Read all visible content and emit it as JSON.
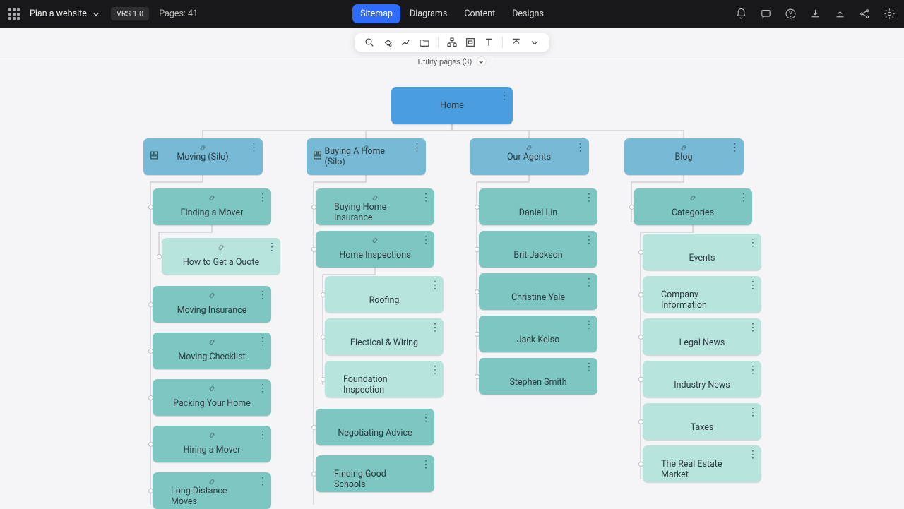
{
  "header": {
    "project_name": "Plan a website",
    "version_pill": "VRS 1.0",
    "pages_label": "Pages: 41",
    "tabs": {
      "sitemap": "Sitemap",
      "diagrams": "Diagrams",
      "content": "Content",
      "designs": "Designs"
    }
  },
  "utility_strip": {
    "label": "Utility pages (3)"
  },
  "sitemap": {
    "root": "Home",
    "sections": [
      {
        "title": "Moving (Silo)",
        "has_silo_icon": true,
        "children": [
          {
            "title": "Finding a Mover",
            "link": true,
            "children": [
              {
                "title": "How to Get a Quote",
                "link": true
              }
            ]
          },
          {
            "title": "Moving Insurance",
            "link": true
          },
          {
            "title": "Moving Checklist",
            "link": true
          },
          {
            "title": "Packing Your Home",
            "link": true
          },
          {
            "title": "Hiring a Mover",
            "link": true
          },
          {
            "title": "Long Distance Moves",
            "link": true
          }
        ]
      },
      {
        "title": "Buying A Home (Silo)",
        "has_silo_icon": true,
        "children": [
          {
            "title": "Buying Home Insurance",
            "link": true
          },
          {
            "title": "Home Inspections",
            "link": true,
            "children": [
              {
                "title": "Roofing"
              },
              {
                "title": "Electical & Wiring"
              },
              {
                "title": "Foundation Inspection"
              }
            ]
          },
          {
            "title": "Negotiating Advice"
          },
          {
            "title": "Finding Good Schools"
          }
        ]
      },
      {
        "title": "Our Agents",
        "has_silo_icon": false,
        "children": [
          {
            "title": "Daniel Lin"
          },
          {
            "title": "Brit Jackson"
          },
          {
            "title": "Christine Yale"
          },
          {
            "title": "Jack Kelso"
          },
          {
            "title": "Stephen Smith"
          }
        ]
      },
      {
        "title": "Blog",
        "has_silo_icon": false,
        "children": [
          {
            "title": "Categories",
            "link": true,
            "children": [
              {
                "title": "Events"
              },
              {
                "title": "Company Information"
              },
              {
                "title": "Legal News"
              },
              {
                "title": "Industry News"
              },
              {
                "title": "Taxes"
              },
              {
                "title": "The Real Estate Market"
              }
            ]
          }
        ]
      }
    ]
  }
}
